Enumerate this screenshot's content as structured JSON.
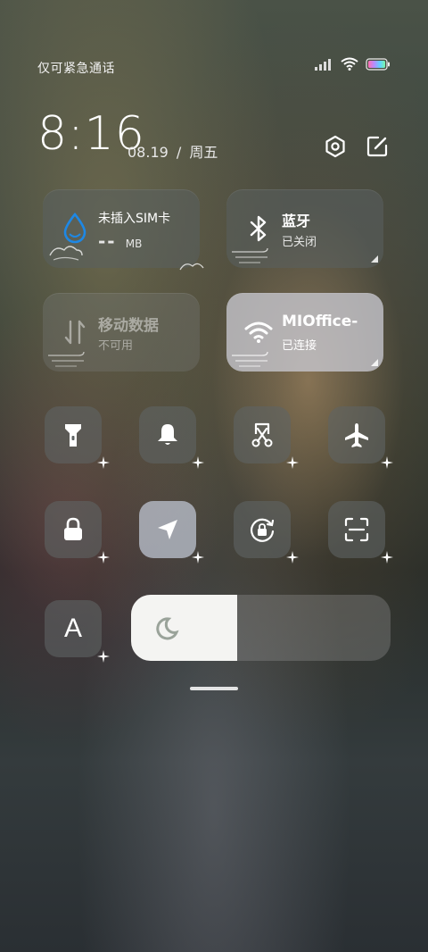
{
  "status_bar": {
    "carrier": "仅可紧急通话",
    "icons": [
      "signal-icon",
      "wifi-icon",
      "battery-icon"
    ]
  },
  "header": {
    "time": "8:16",
    "date": "08.19",
    "separator": "/",
    "weekday": "周五",
    "buttons": [
      "settings-icon",
      "edit-icon"
    ]
  },
  "tiles": {
    "data_usage": {
      "title": "未插入SIM卡",
      "value": "--",
      "unit": "MB"
    },
    "bluetooth": {
      "title": "蓝牙",
      "status": "已关闭"
    },
    "mobile_data": {
      "title": "移动数据",
      "status": "不可用"
    },
    "wifi": {
      "title": "MIOffice-",
      "status": "已连接"
    }
  },
  "quick_toggles": [
    {
      "name": "flashlight",
      "icon": "flashlight-icon",
      "active": false
    },
    {
      "name": "ringer",
      "icon": "bell-icon",
      "active": false
    },
    {
      "name": "screenshot",
      "icon": "scissors-icon",
      "active": false
    },
    {
      "name": "airplane-mode",
      "icon": "airplane-icon",
      "active": false
    },
    {
      "name": "lock-screen",
      "icon": "lock-icon",
      "active": false
    },
    {
      "name": "location",
      "icon": "location-arrow-icon",
      "active": true
    },
    {
      "name": "rotation-lock",
      "icon": "rotation-lock-icon",
      "active": false
    },
    {
      "name": "scanner",
      "icon": "scan-icon",
      "active": false
    }
  ],
  "font_size_button": {
    "label": "A"
  },
  "brightness": {
    "level": 0.41,
    "icon": "moon-icon"
  },
  "colors": {
    "tile_bg": "#5a6060",
    "tile_active_bg": "#c8c8d0",
    "brightness_fill": "#f4f4f2",
    "water_drop": "#1e88e5"
  }
}
